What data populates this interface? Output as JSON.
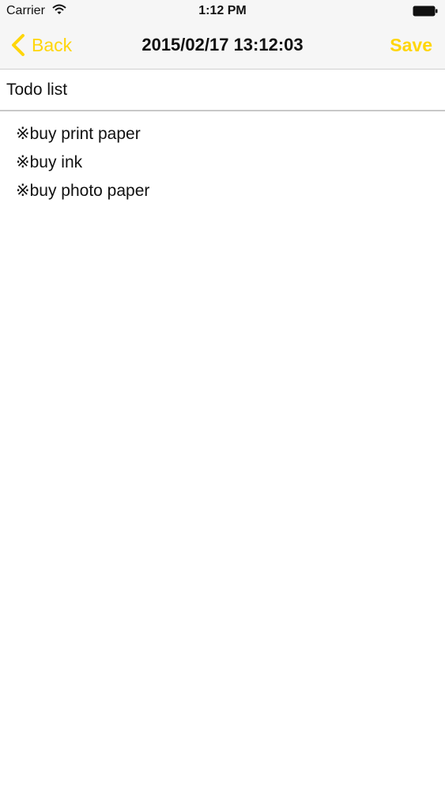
{
  "status_bar": {
    "carrier": "Carrier",
    "time": "1:12 PM",
    "wifi_icon": "wifi-icon",
    "battery_icon": "battery-icon"
  },
  "nav": {
    "back_label": "Back",
    "title": "2015/02/17 13:12:03",
    "save_label": "Save",
    "accent_color": "#ffd60a"
  },
  "note": {
    "title": "Todo list",
    "lines": [
      "※buy print paper",
      "※buy ink",
      "※buy photo paper"
    ]
  }
}
